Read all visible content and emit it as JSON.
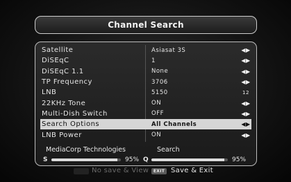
{
  "title": "Channel Search",
  "rows": [
    {
      "label": "Satellite",
      "value": "Asiasat 3S",
      "arrow": "◀▶",
      "selected": false
    },
    {
      "label": "DiSEqC",
      "value": "1",
      "arrow": "◀▶",
      "selected": false
    },
    {
      "label": "DiSEqC 1.1",
      "value": "None",
      "arrow": "◀▶",
      "selected": false
    },
    {
      "label": "TP Frequency",
      "value": "3706",
      "arrow": "◀▶",
      "selected": false
    },
    {
      "label": "LNB",
      "value": "5150",
      "arrow": "keypad-icon",
      "selected": false
    },
    {
      "label": "22KHz Tone",
      "value": "ON",
      "arrow": "◀▶",
      "selected": false
    },
    {
      "label": "Multi-Dish Switch",
      "value": "OFF",
      "arrow": "◀▶",
      "selected": false
    },
    {
      "label": "Search Options",
      "value": "All Channels",
      "arrow": "◀▶",
      "selected": true
    },
    {
      "label": "LNB Power",
      "value": "ON",
      "arrow": "◀▶",
      "selected": false
    }
  ],
  "info": {
    "satellite_name": "MediaCorp Technologies",
    "mode": "Search"
  },
  "signal": {
    "s_label": "S",
    "s_value": 95,
    "s_text": "95%",
    "q_label": "Q",
    "q_value": 95,
    "q_text": "95%"
  },
  "footer": {
    "red_label": "No save & View",
    "exit_key": "EXIT",
    "exit_label": "Save & Exit"
  },
  "colors": {
    "selected_bg": "#d6d6d6",
    "bar_fill": "#dcdcdc"
  }
}
